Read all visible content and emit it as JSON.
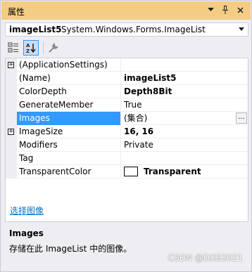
{
  "window": {
    "title": "属性",
    "icons": [
      "dropdown-arrow-icon",
      "pin-icon",
      "close-icon"
    ]
  },
  "object_selector": {
    "name": "imageList5",
    "type": "System.Windows.Forms.ImageList"
  },
  "toolbar": {
    "buttons": [
      "categorized-icon",
      "alphabetical-icon",
      "property-pages-icon"
    ]
  },
  "grid": {
    "rows": [
      {
        "name": "(ApplicationSettings)",
        "value": "",
        "expandable": true,
        "bold": false,
        "selected": false
      },
      {
        "name": "(Name)",
        "value": "imageList5",
        "expandable": false,
        "bold": true,
        "selected": false
      },
      {
        "name": "ColorDepth",
        "value": "Depth8Bit",
        "expandable": false,
        "bold": true,
        "selected": false
      },
      {
        "name": "GenerateMember",
        "value": "True",
        "expandable": false,
        "bold": false,
        "selected": false
      },
      {
        "name": "Images",
        "value": "(集合)",
        "expandable": false,
        "bold": false,
        "selected": true,
        "ellipsis": "..."
      },
      {
        "name": "ImageSize",
        "value": "16, 16",
        "expandable": true,
        "bold": true,
        "selected": false
      },
      {
        "name": "Modifiers",
        "value": "Private",
        "expandable": false,
        "bold": false,
        "selected": false
      },
      {
        "name": "Tag",
        "value": "",
        "expandable": false,
        "bold": false,
        "selected": false
      },
      {
        "name": "TransparentColor",
        "value": "Transparent",
        "expandable": false,
        "bold": true,
        "selected": false,
        "swatch": "#ffffff"
      }
    ]
  },
  "commands": {
    "link": "选择图像"
  },
  "description": {
    "title": "Images",
    "text": "存储在此 ImageList 中的图像。"
  },
  "watermark": "CSDN @DXB2021",
  "colors": {
    "titlebar": "#f5cc84",
    "selection": "#3399ff",
    "link": "#0e70c0",
    "background": "#eeeef2"
  }
}
